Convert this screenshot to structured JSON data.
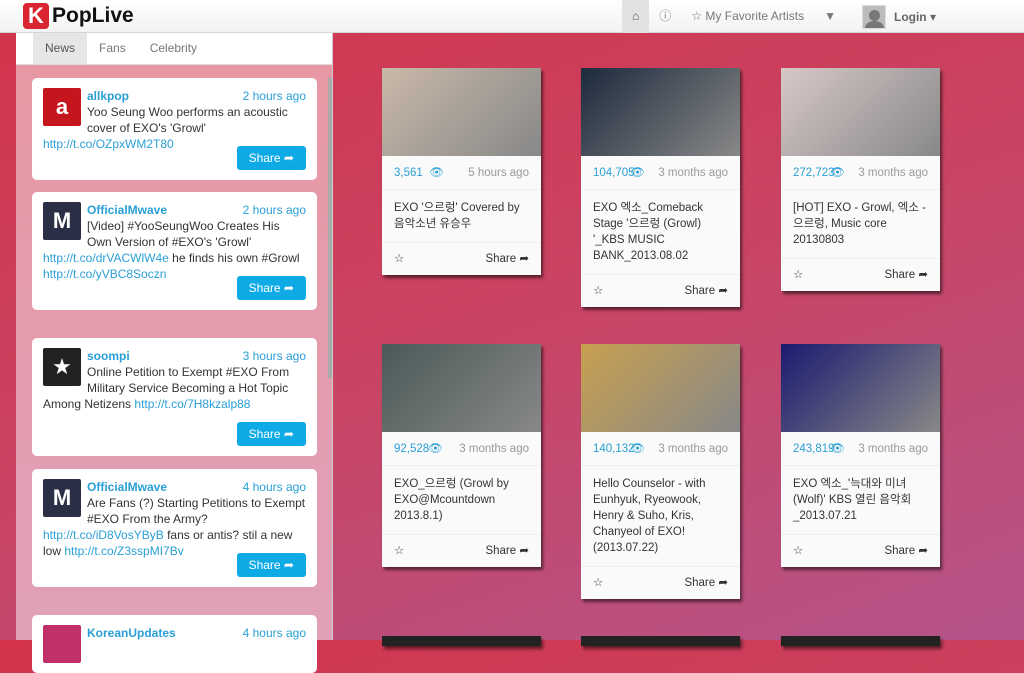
{
  "header": {
    "logo_letter": "K",
    "app_title": "PopLive",
    "nav": {
      "home_icon": "⌂",
      "info_icon": "ⓘ",
      "favorites": "☆ My Favorite Artists",
      "filter_icon": "▼",
      "login": "Login ▾"
    }
  },
  "sidebar": {
    "tabs": [
      "News",
      "Fans",
      "Celebrity"
    ],
    "tweets": [
      {
        "user": "allkpop",
        "time": "2 hours ago",
        "text": "Yoo Seung Woo performs an acoustic cover of EXO's 'Growl' ",
        "links": [
          "http://t.co/OZpxWM2T80"
        ],
        "text2": "",
        "share": "Share ➦",
        "avatar_color": "#c4161c",
        "avatar_glyph": "a"
      },
      {
        "user": "OfficialMwave",
        "time": "2 hours ago",
        "text": "[Video] #YooSeungWoo Creates His Own Version of #EXO's 'Growl' ",
        "links": [
          "http://t.co/drVACWlW4e",
          "http://t.co/yVBC8Soczn"
        ],
        "text2": " he finds his own #Growl ",
        "share": "Share ➦",
        "avatar_color": "#2a2f45",
        "avatar_glyph": "M"
      },
      {
        "user": "soompi",
        "time": "3 hours ago",
        "text": "Online Petition to Exempt #EXO From Military Service Becoming a Hot Topic Among Netizens ",
        "links": [
          "http://t.co/7H8kzalp88"
        ],
        "text2": "",
        "share": "Share ➦",
        "avatar_color": "#222",
        "avatar_glyph": "★"
      },
      {
        "user": "OfficialMwave",
        "time": "4 hours ago",
        "text": "Are Fans (?) Starting Petitions to Exempt #EXO From the Army? ",
        "links": [
          "http://t.co/iD8VosYByB",
          "http://t.co/Z3sspMI7Bv"
        ],
        "text2": " fans or antis? stil a new low ",
        "share": "Share ➦",
        "avatar_color": "#2a2f45",
        "avatar_glyph": "M"
      },
      {
        "user": "KoreanUpdates",
        "time": "4 hours ago",
        "avatar_color": "#c0306a",
        "avatar_glyph": ""
      }
    ]
  },
  "videos": [
    {
      "views": "3,561",
      "ago": "5 hours ago",
      "title": "EXO '으르렁' Covered by 음악소년 유승우",
      "share": "Share ➦",
      "img": "#c9b9a8"
    },
    {
      "views": "104,705",
      "ago": "3 months ago",
      "title": "EXO 엑소_Comeback Stage '으르렁 (Growl) '_KBS MUSIC BANK_2013.08.02",
      "share": "Share ➦",
      "img": "#1c2a3c"
    },
    {
      "views": "272,723",
      "ago": "3 months ago",
      "title": "[HOT] EXO - Growl, 엑소 - 으르렁, Music core 20130803",
      "share": "Share ➦",
      "img": "#d8c8c8"
    },
    {
      "views": "92,528",
      "ago": "3 months ago",
      "title": "EXO_으르렁 (Growl by EXO@Mcountdown 2013.8.1)",
      "share": "Share ➦",
      "img": "#4a5a58"
    },
    {
      "views": "140,132",
      "ago": "3 months ago",
      "title": "Hello Counselor - with Eunhyuk, Ryeowook, Henry & Suho, Kris, Chanyeol of EXO! (2013.07.22)",
      "share": "Share ➦",
      "img": "#c8a050"
    },
    {
      "views": "243,819",
      "ago": "3 months ago",
      "title": "EXO 엑소_'늑대와 미녀 (Wolf)' KBS 열린 음악회 _2013.07.21",
      "share": "Share ➦",
      "img": "#1a1a70"
    }
  ]
}
